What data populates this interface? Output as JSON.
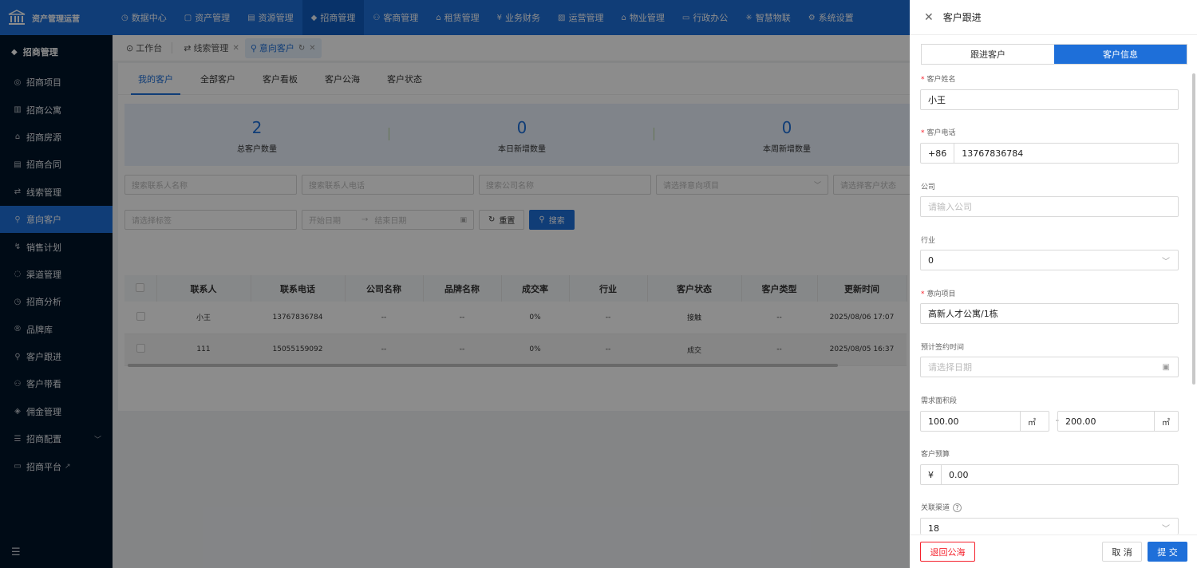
{
  "app": {
    "title": "资产管理运营"
  },
  "topnav": [
    {
      "icon": "◷",
      "label": "数据中心"
    },
    {
      "icon": "▢",
      "label": "资产管理"
    },
    {
      "icon": "▤",
      "label": "资源管理"
    },
    {
      "icon": "◆",
      "label": "招商管理"
    },
    {
      "icon": "⚇",
      "label": "客商管理"
    },
    {
      "icon": "⌂",
      "label": "租赁管理"
    },
    {
      "icon": "¥",
      "label": "业务财务"
    },
    {
      "icon": "▨",
      "label": "运营管理"
    },
    {
      "icon": "⌂",
      "label": "物业管理"
    },
    {
      "icon": "▭",
      "label": "行政办公"
    },
    {
      "icon": "✳",
      "label": "智慧物联"
    },
    {
      "icon": "⚙",
      "label": "系统设置"
    }
  ],
  "sidebar": {
    "title": "招商管理",
    "items": [
      {
        "icon": "◎",
        "label": "招商项目"
      },
      {
        "icon": "▥",
        "label": "招商公寓"
      },
      {
        "icon": "⌂",
        "label": "招商房源"
      },
      {
        "icon": "▤",
        "label": "招商合同"
      },
      {
        "icon": "⇄",
        "label": "线索管理"
      },
      {
        "icon": "⚲",
        "label": "意向客户"
      },
      {
        "icon": "↯",
        "label": "销售计划"
      },
      {
        "icon": "◌",
        "label": "渠道管理"
      },
      {
        "icon": "◷",
        "label": "招商分析"
      },
      {
        "icon": "®",
        "label": "品牌库"
      },
      {
        "icon": "⚲",
        "label": "客户跟进"
      },
      {
        "icon": "⚇",
        "label": "客户带看"
      },
      {
        "icon": "◈",
        "label": "佣金管理"
      },
      {
        "icon": "☰",
        "label": "招商配置"
      },
      {
        "icon": "▭",
        "label": "招商平台"
      }
    ]
  },
  "pagetabs": [
    {
      "icon": "⊙",
      "label": "工作台"
    },
    {
      "icon": "⇄",
      "label": "线索管理"
    },
    {
      "icon": "⚲",
      "label": "意向客户"
    }
  ],
  "subtabs": [
    "我的客户",
    "全部客户",
    "客户看板",
    "客户公海",
    "客户状态"
  ],
  "stats": [
    {
      "value": "2",
      "label": "总客户数量"
    },
    {
      "value": "0",
      "label": "本日新增数量"
    },
    {
      "value": "0",
      "label": "本周新增数量"
    }
  ],
  "filters": {
    "contact_name": "搜索联系人名称",
    "contact_phone": "搜索联系人电话",
    "company": "搜索公司名称",
    "project": "请选择意向项目",
    "status": "请选择客户状态",
    "tags": "请选择标签",
    "start_date": "开始日期",
    "arrow": "→",
    "end_date": "结束日期",
    "reset": "重置",
    "search": "搜索"
  },
  "table": {
    "headers": [
      "联系人",
      "联系电话",
      "公司名称",
      "品牌名称",
      "成交率",
      "行业",
      "客户状态",
      "客户类型",
      "更新时间"
    ],
    "rows": [
      [
        "小王",
        "13767836784",
        "--",
        "--",
        "0%",
        "--",
        "接触",
        "--",
        "2025/08/06 17:07"
      ],
      [
        "111",
        "15055159092",
        "--",
        "--",
        "0%",
        "--",
        "成交",
        "--",
        "2025/08/05 16:37"
      ]
    ]
  },
  "drawer": {
    "title": "客户跟进",
    "seg": [
      "跟进客户",
      "客户信息"
    ],
    "name_label": "客户姓名",
    "name_value": "小王",
    "phone_label": "客户电话",
    "phone_prefix": "+86",
    "phone_value": "13767836784",
    "company_label": "公司",
    "company_placeholder": "请输入公司",
    "industry_label": "行业",
    "industry_value": "0",
    "project_label": "意向项目",
    "project_value": "高新人才公寓/1栋",
    "sign_label": "预计签约时间",
    "sign_placeholder": "请选择日期",
    "area_label": "需求面积段",
    "area_min": "100.00",
    "area_max": "200.00",
    "area_unit": "㎡",
    "area_dash": "-",
    "budget_label": "客户预算",
    "budget_prefix": "¥",
    "budget_value": "0.00",
    "channel_label": "关联渠道",
    "channel_value": "18",
    "btn_return": "退回公海",
    "btn_cancel": "取 消",
    "btn_submit": "提 交"
  },
  "colors": {
    "primary": "#1e6fd9",
    "sidebar": "#001529",
    "danger": "#f5222d"
  }
}
